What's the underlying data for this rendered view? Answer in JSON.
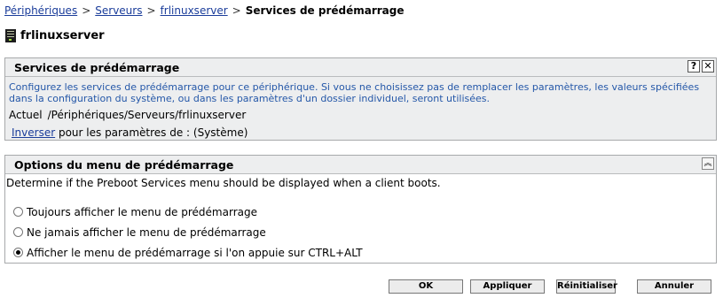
{
  "breadcrumb": {
    "items": [
      "Périphériques",
      "Serveurs",
      "frlinuxserver"
    ],
    "current": "Services de prédémarrage",
    "separator": ">"
  },
  "server": {
    "name": "frlinuxserver",
    "icon": "server-icon"
  },
  "settings_panel": {
    "title": "Services de prédémarrage",
    "help_label": "?",
    "close_label": "✕",
    "description": "Configurez les services de prédémarrage pour ce périphérique. Si vous ne choisissez pas de remplacer les paramètres, les valeurs spécifiées dans la configuration du système, ou dans les paramètres d'un dossier individuel, seront utilisées.",
    "actuel_label": "Actuel",
    "actuel_path": "/Périphériques/Serveurs/frlinuxserver",
    "inverse_link": "Inverser",
    "inverse_text": "pour les paramètres de : (Système)"
  },
  "menu_panel": {
    "title": "Options du menu de prédémarrage",
    "collapse_icon": "double-chevron-up-icon",
    "description": "Determine if the Preboot Services menu should be displayed when a client boots.",
    "options": [
      {
        "label": "Toujours afficher le menu de prédémarrage",
        "selected": false
      },
      {
        "label": "Ne jamais afficher le menu de prédémarrage",
        "selected": false
      },
      {
        "label": "Afficher le menu de prédémarrage si l'on appuie sur CTRL+ALT",
        "selected": true
      }
    ]
  },
  "buttons": {
    "ok": "OK",
    "apply": "Appliquer",
    "reset": "Réinitialiser",
    "cancel": "Annuler"
  },
  "colors": {
    "link": "#1a3c9a",
    "description_text": "#2457a8",
    "panel_bg": "#edeeef",
    "panel_border": "#a7a9ab"
  }
}
